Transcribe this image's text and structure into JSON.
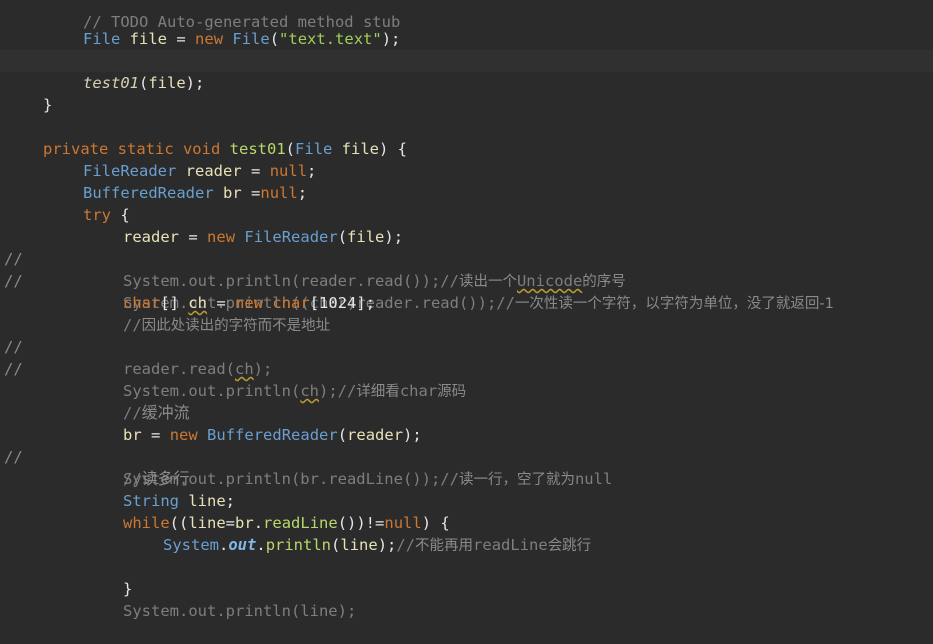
{
  "editor": {
    "lines": [
      "// TODO Auto-generated method stub",
      "File file = new File(\"text.text\");",
      "",
      "test01(file);",
      "}",
      "",
      "private static void test01(File file) {",
      "FileReader reader = null;",
      "BufferedReader br =null;",
      "try {",
      "reader = new FileReader(file);",
      "System.out.println(reader.read());//读出一个Unicode的序号",
      "System.out.println((char)reader.read());//一次性读一个字符，以字符为单位，没了就返回-1",
      "char[] ch = new char[1024];",
      "//因此处读出的字符而不是地址",
      "reader.read(ch);",
      "System.out.println(ch);//详细看char源码",
      "",
      "//缓冲流",
      "br = new BufferedReader(reader);",
      "System.out.println(br.readLine());//读一行，空了就为null",
      "//读多行",
      "String line;",
      "while((line=br.readLine())!=null) {",
      "System.out.println(line);//不能再用readLine会跳行",
      "",
      "}",
      "System.out.println(line);"
    ],
    "gutter_mark": "//"
  }
}
